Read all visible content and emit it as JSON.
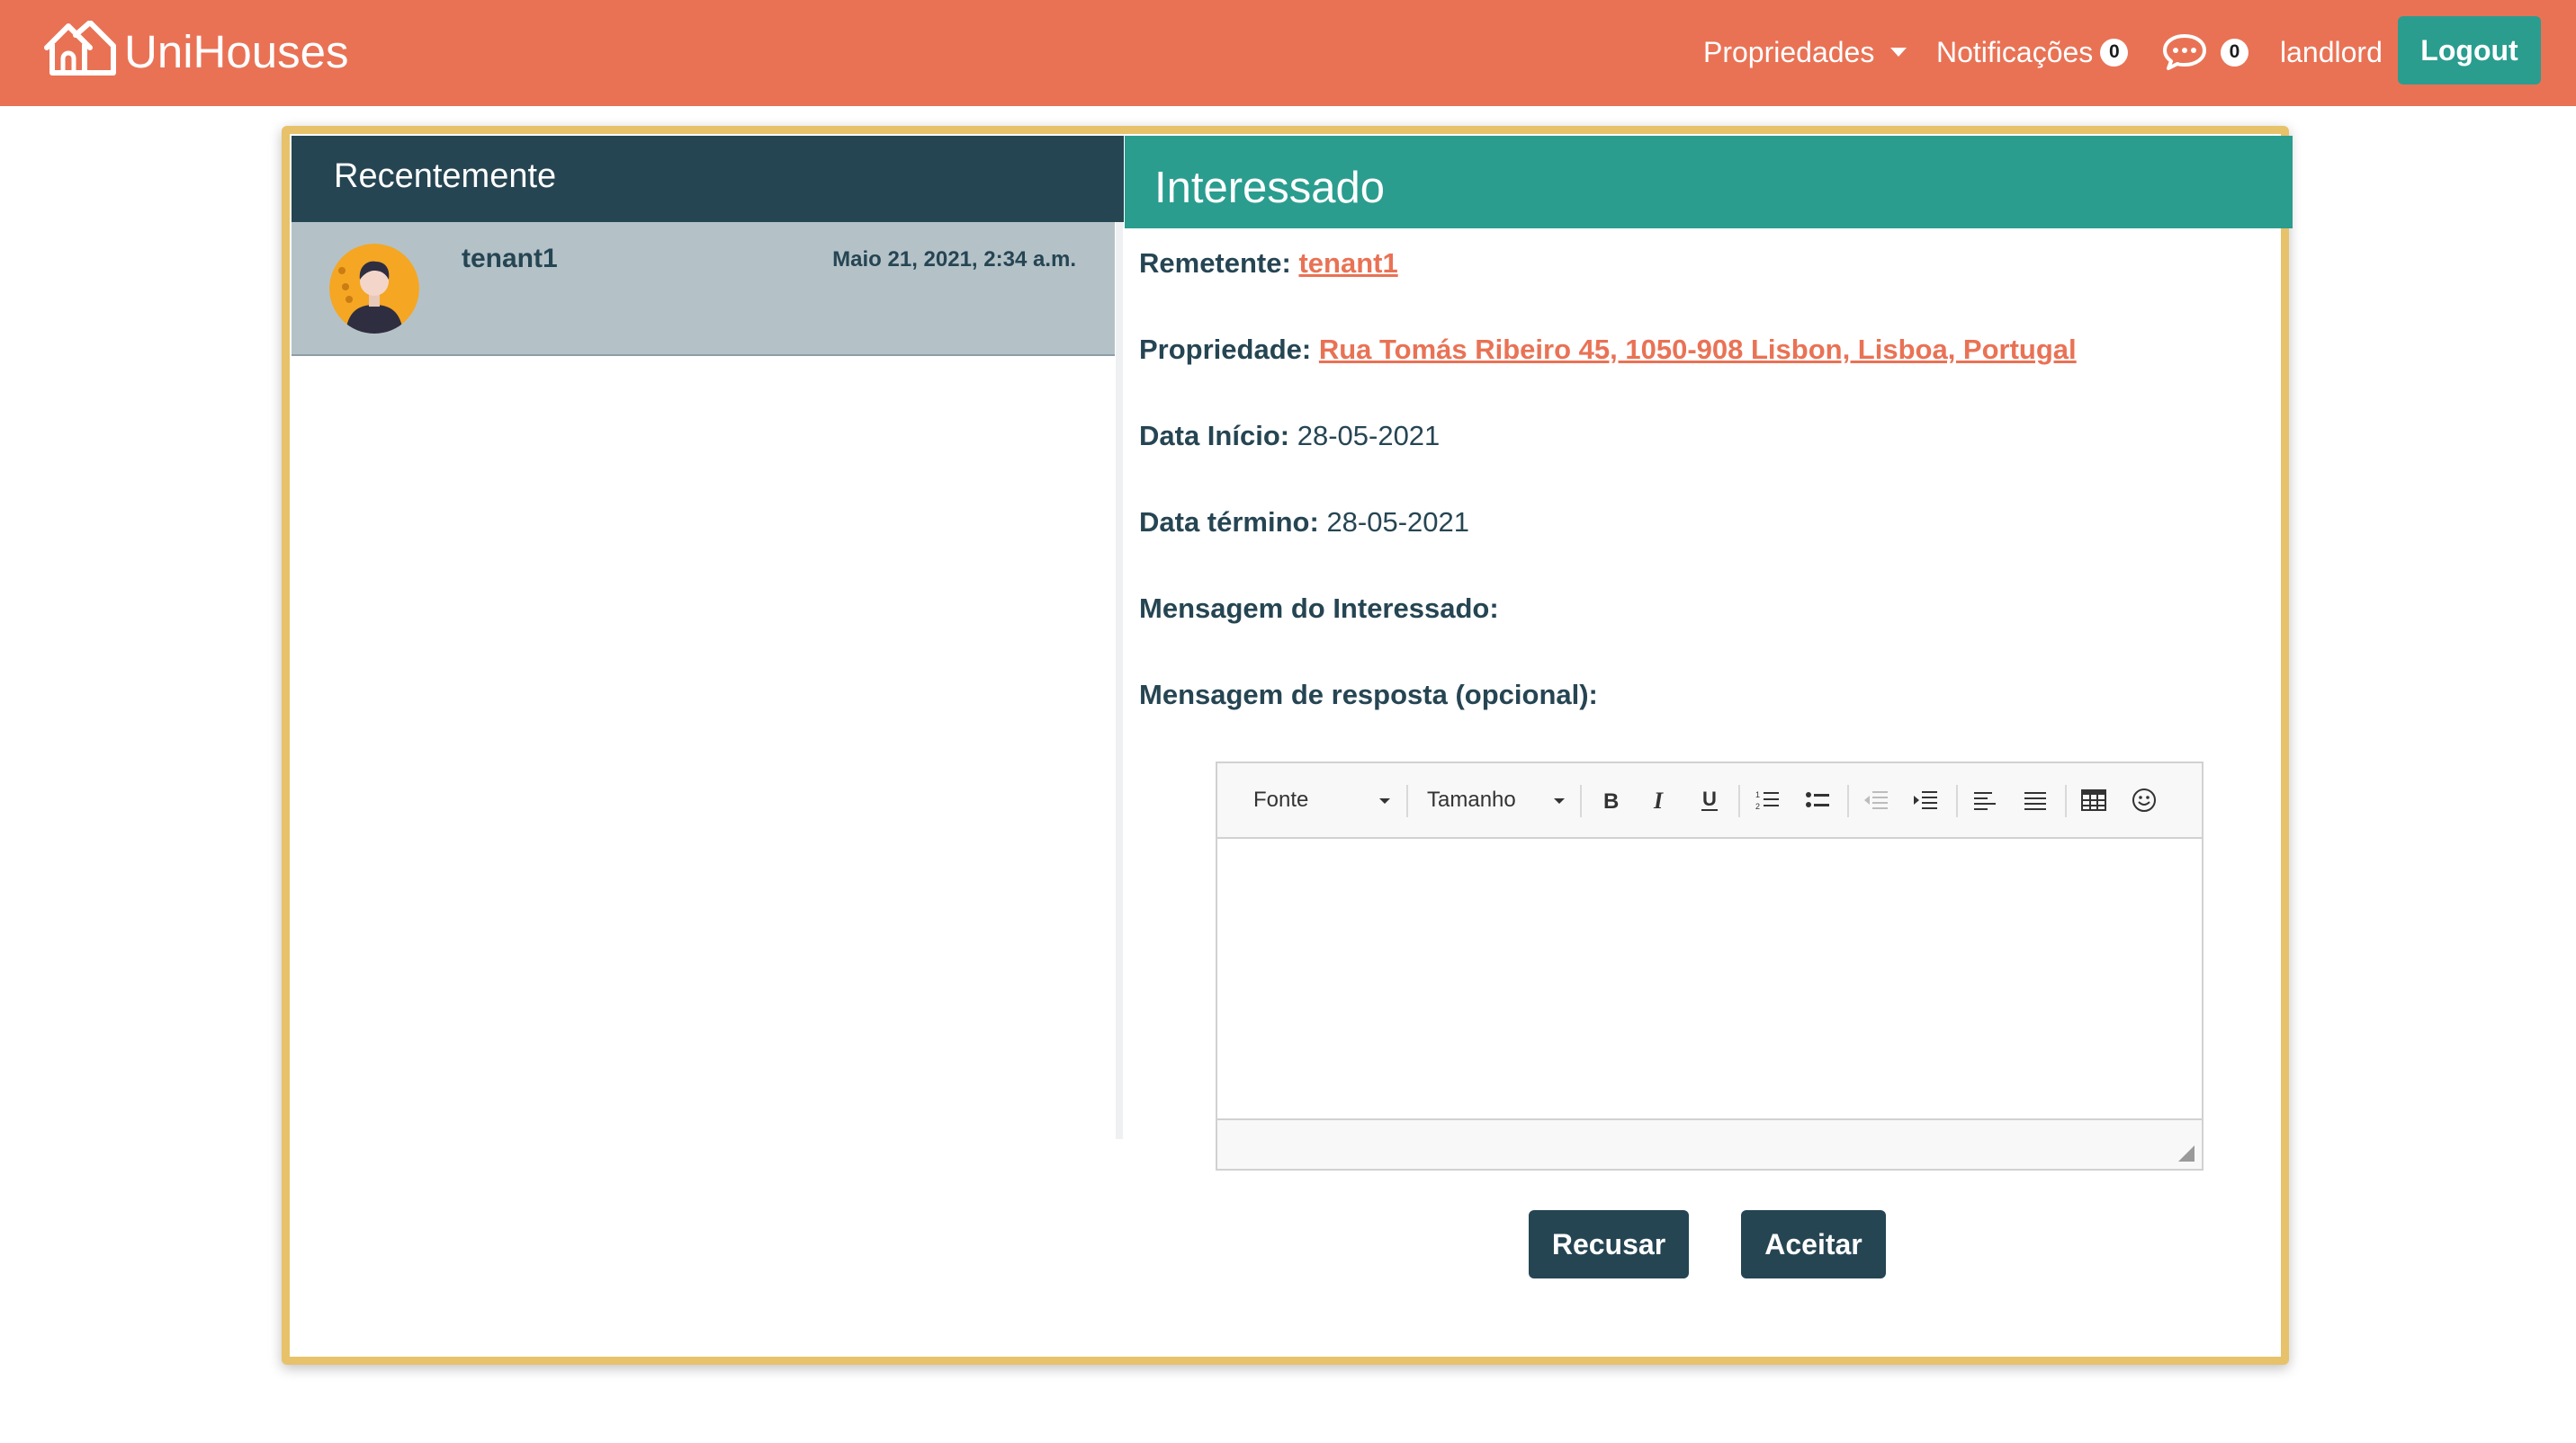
{
  "navbar": {
    "brand": "UniHouses",
    "properties_label": "Propriedades",
    "notifications_label": "Notificações",
    "notifications_count": "0",
    "messages_count": "0",
    "username": "landlord",
    "logout_label": "Logout"
  },
  "recent": {
    "title": "Recentemente",
    "conversations": [
      {
        "name": "tenant1",
        "date": "Maio 21, 2021, 2:34 a.m."
      }
    ]
  },
  "detail": {
    "title": "Interessado",
    "sender_label": "Remetente:",
    "sender_value": "tenant1",
    "property_label": "Propriedade:",
    "property_value": "Rua Tomás Ribeiro 45, 1050-908 Lisbon, Lisboa, Portugal",
    "start_label": "Data Início:",
    "start_value": "28-05-2021",
    "end_label": "Data término:",
    "end_value": "28-05-2021",
    "message_label": "Mensagem do Interessado:",
    "reply_label": "Mensagem de resposta (opcional):"
  },
  "editor": {
    "font_label": "Fonte",
    "size_label": "Tamanho",
    "tools": [
      "bold-icon",
      "italic-icon",
      "underline-icon",
      "ordered-list-icon",
      "bullet-list-icon",
      "outdent-icon",
      "indent-icon",
      "align-left-icon",
      "justify-icon",
      "table-icon",
      "emoji-icon"
    ]
  },
  "actions": {
    "refuse_label": "Recusar",
    "accept_label": "Aceitar"
  },
  "colors": {
    "navbar": "#e97255",
    "dark": "#264553",
    "teal": "#2a9d8f",
    "frame": "#e7c26a",
    "selected_row": "#b4c2c8"
  }
}
